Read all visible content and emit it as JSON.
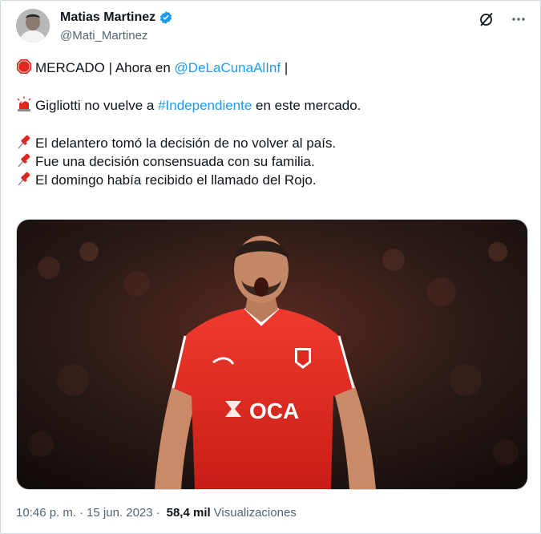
{
  "author": {
    "name": "Matias Martinez",
    "handle": "@Mati_Martinez",
    "verified": true
  },
  "tweet": {
    "line1_prefix": "MERCADO | Ahora en ",
    "line1_mention": "@DeLaCunaAlInf",
    "line1_suffix": " |",
    "line2_prefix": "Gigliotti no vuelve a ",
    "line2_hashtag": "#Independiente",
    "line2_suffix": " en este mercado.",
    "line3": "El delantero tomó la decisión de no volver al país.",
    "line4": "Fue una decisión consensuada con su familia.",
    "line5": "El domingo había recibido el llamado del Rojo."
  },
  "media": {
    "shirt_sponsor": "OCA"
  },
  "meta": {
    "time": "10:46 p. m.",
    "separator": "·",
    "date": "15 jun. 2023",
    "views_count": "58,4 mil",
    "views_label": "Visualizaciones"
  },
  "icons": [
    "grok-icon",
    "more-icon",
    "stop-sign-emoji",
    "rotating-light-emoji",
    "pushpin-emoji",
    "verified-badge-icon"
  ],
  "colors": {
    "link": "#1d9bf0",
    "text": "#0f1419",
    "secondary": "#536471",
    "jersey_red": "#e0261f"
  }
}
